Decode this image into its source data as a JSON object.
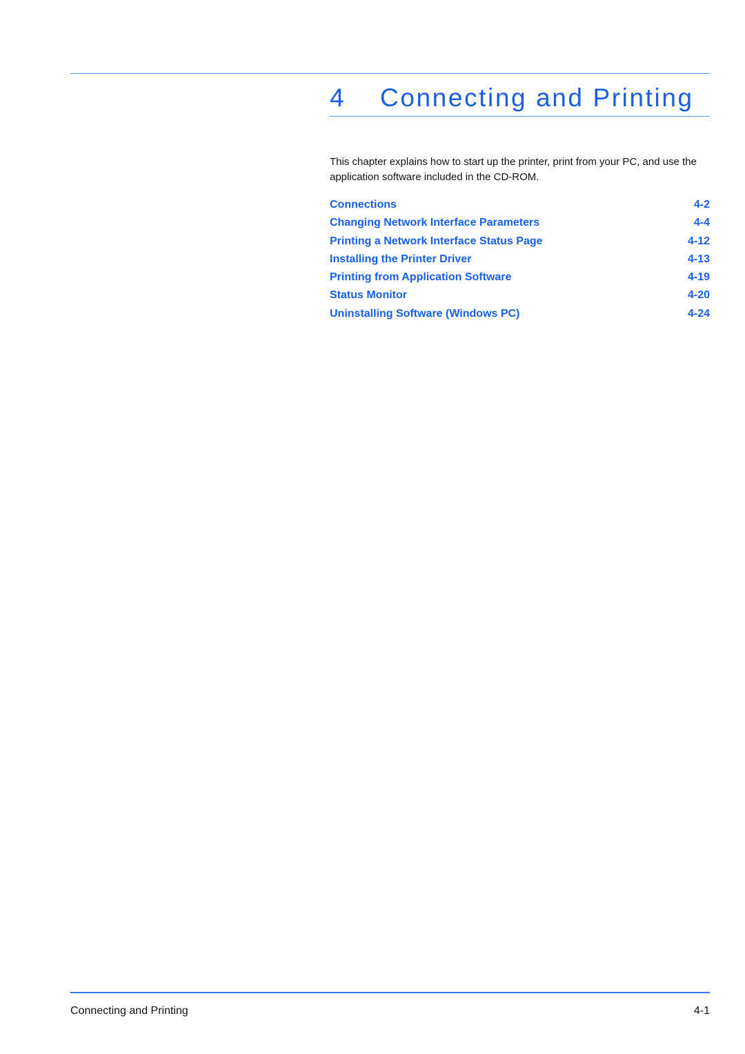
{
  "colors": {
    "accent": "#1a5fe0",
    "rule": "#5b8ee6",
    "text": "#111111"
  },
  "chapter": {
    "number": "4",
    "title": "Connecting and Printing"
  },
  "intro": "This chapter explains how to start up the printer, print from your PC, and use the application software included in the CD-ROM.",
  "toc": [
    {
      "label": "Connections",
      "page": "4-2"
    },
    {
      "label": "Changing Network Interface Parameters",
      "page": "4-4"
    },
    {
      "label": "Printing a Network Interface Status Page",
      "page": "4-12"
    },
    {
      "label": "Installing the Printer Driver",
      "page": "4-13"
    },
    {
      "label": "Printing from Application Software",
      "page": "4-19"
    },
    {
      "label": "Status Monitor",
      "page": "4-20"
    },
    {
      "label": "Uninstalling Software (Windows PC)",
      "page": "4-24"
    }
  ],
  "footer": {
    "title": "Connecting and Printing",
    "page": "4-1"
  }
}
